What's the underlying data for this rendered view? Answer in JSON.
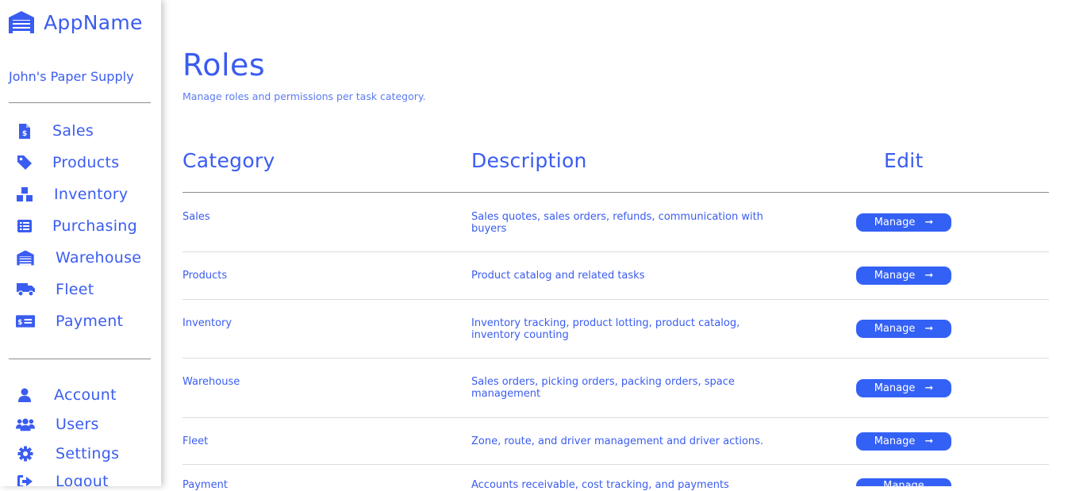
{
  "app": {
    "name": "AppName",
    "company": "John's Paper Supply"
  },
  "sidebar": {
    "nav": [
      {
        "label": "Sales",
        "icon": "receipt-dollar-icon"
      },
      {
        "label": "Products",
        "icon": "tag-icon"
      },
      {
        "label": "Inventory",
        "icon": "boxes-icon"
      },
      {
        "label": "Purchasing",
        "icon": "list-icon"
      },
      {
        "label": "Warehouse",
        "icon": "warehouse-icon"
      },
      {
        "label": "Fleet",
        "icon": "truck-icon"
      },
      {
        "label": "Payment",
        "icon": "money-check-icon"
      }
    ],
    "account": [
      {
        "label": "Account",
        "icon": "user-icon"
      },
      {
        "label": "Users",
        "icon": "users-icon"
      },
      {
        "label": "Settings",
        "icon": "gear-icon"
      },
      {
        "label": "Logout",
        "icon": "sign-out-icon"
      }
    ]
  },
  "page": {
    "title": "Roles",
    "subtitle": "Manage roles and permissions per task category."
  },
  "table": {
    "headers": {
      "category": "Category",
      "description": "Description",
      "edit": "Edit"
    },
    "manage_label": "Manage",
    "rows": [
      {
        "category": "Sales",
        "description": "Sales quotes, sales orders, refunds, communication with buyers"
      },
      {
        "category": "Products",
        "description": "Product catalog and related tasks"
      },
      {
        "category": "Inventory",
        "description": "Inventory tracking, product lotting, product catalog, inventory counting"
      },
      {
        "category": "Warehouse",
        "description": "Sales orders, picking orders, packing orders, space management"
      },
      {
        "category": "Fleet",
        "description": "Zone, route, and driver management and driver actions."
      },
      {
        "category": "Payment",
        "description": "Accounts receivable, cost tracking, and payments"
      }
    ]
  },
  "colors": {
    "accent": "#3a5cf0",
    "button": "#3461f5",
    "divider": "#8c8c8c"
  }
}
